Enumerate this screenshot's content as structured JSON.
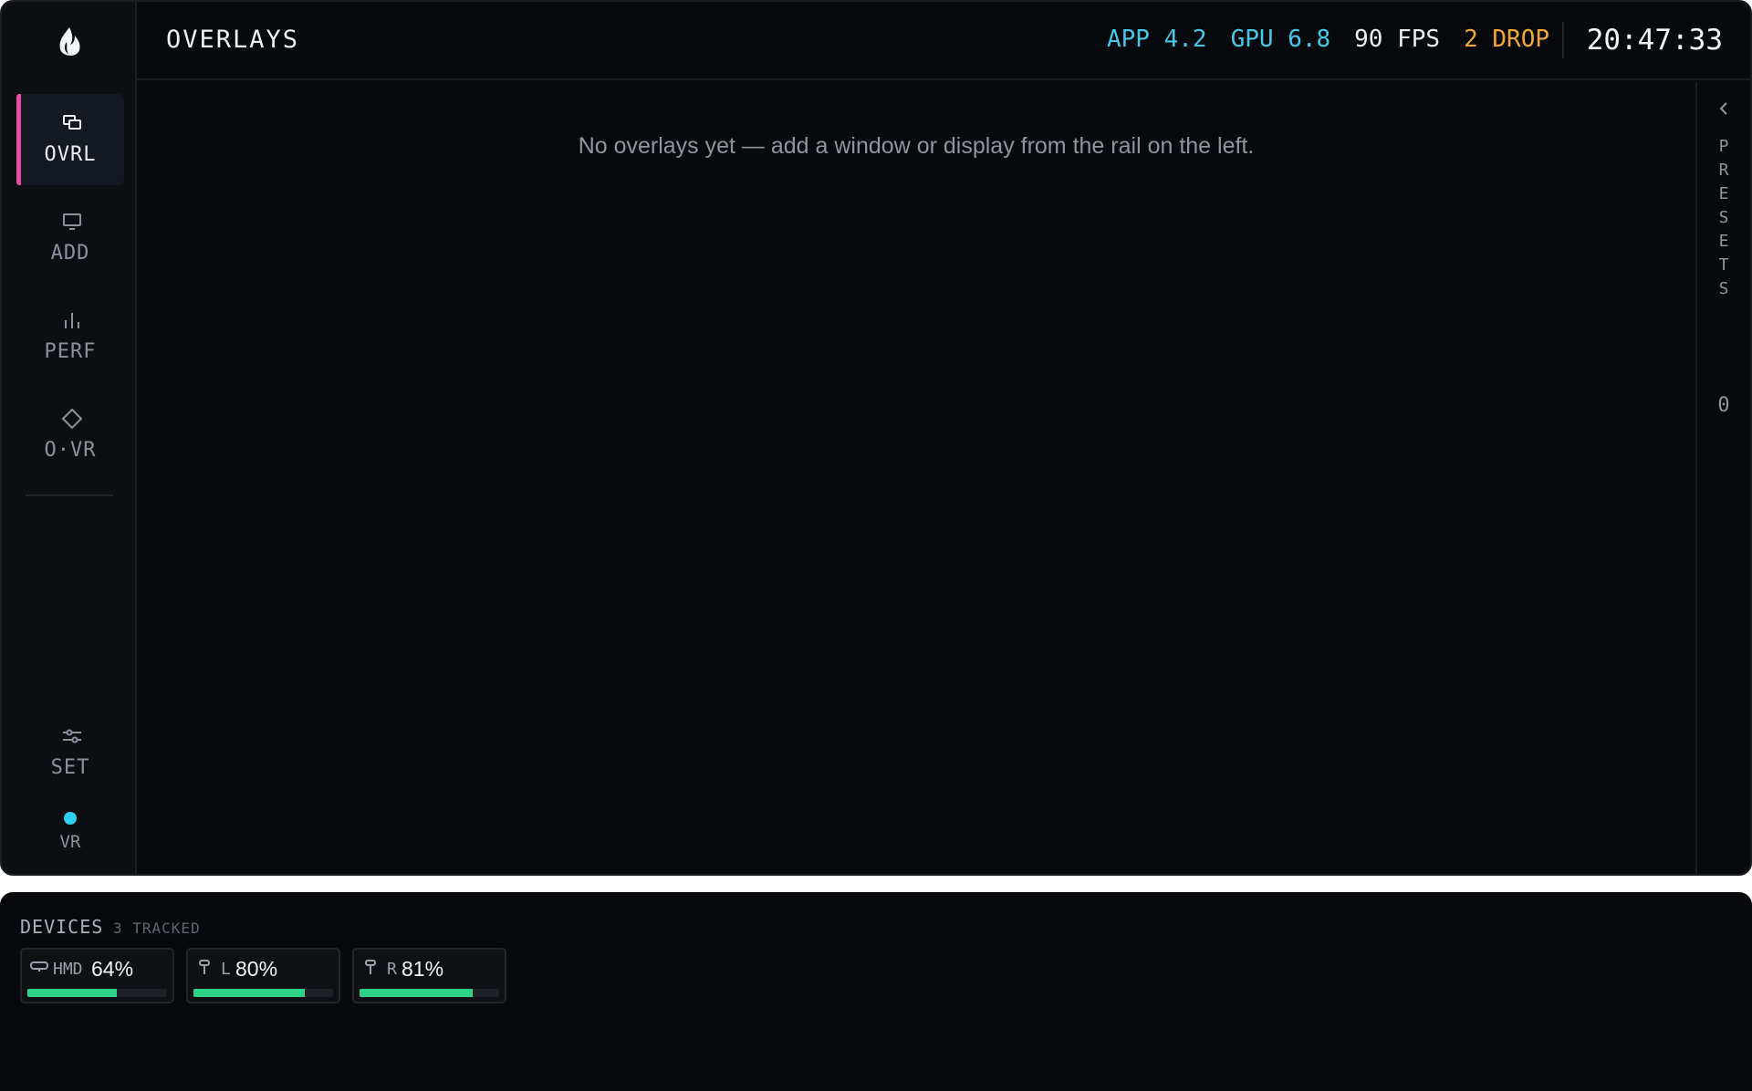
{
  "rail": {
    "items": [
      {
        "label": "OVRL",
        "icon": "overlays-icon"
      },
      {
        "label": "ADD",
        "icon": "monitor-icon"
      },
      {
        "label": "PERF",
        "icon": "bar-chart-icon"
      },
      {
        "label": "O·VR",
        "icon": "diamond-icon"
      }
    ],
    "settings": {
      "label": "SET",
      "icon": "sliders-icon"
    },
    "vr": {
      "label": "VR",
      "color": "#2fd0f0"
    }
  },
  "header": {
    "title": "OVERLAYS",
    "app": "APP 4.2",
    "gpu": "GPU 6.8",
    "fps": "90 FPS",
    "drop": "2 DROP",
    "clock": "20:47:33"
  },
  "main": {
    "empty_message": "No overlays yet — add a window or display from the rail on the left."
  },
  "presets": {
    "label": "PRESETS",
    "count": "0"
  },
  "devices": {
    "title": "DEVICES",
    "count": "3 TRACKED",
    "items": [
      {
        "name": "HMD",
        "battery": "64%",
        "level": 0.64,
        "icon": "headset-icon"
      },
      {
        "name": "L",
        "battery": "80%",
        "level": 0.8,
        "icon": "controller-icon"
      },
      {
        "name": "R",
        "battery": "81%",
        "level": 0.81,
        "icon": "controller-icon"
      }
    ]
  },
  "colors": {
    "accent": "#e84aa4",
    "cyan": "#46c8e8",
    "warning": "#f0a83a",
    "battery": "#2fd188"
  }
}
